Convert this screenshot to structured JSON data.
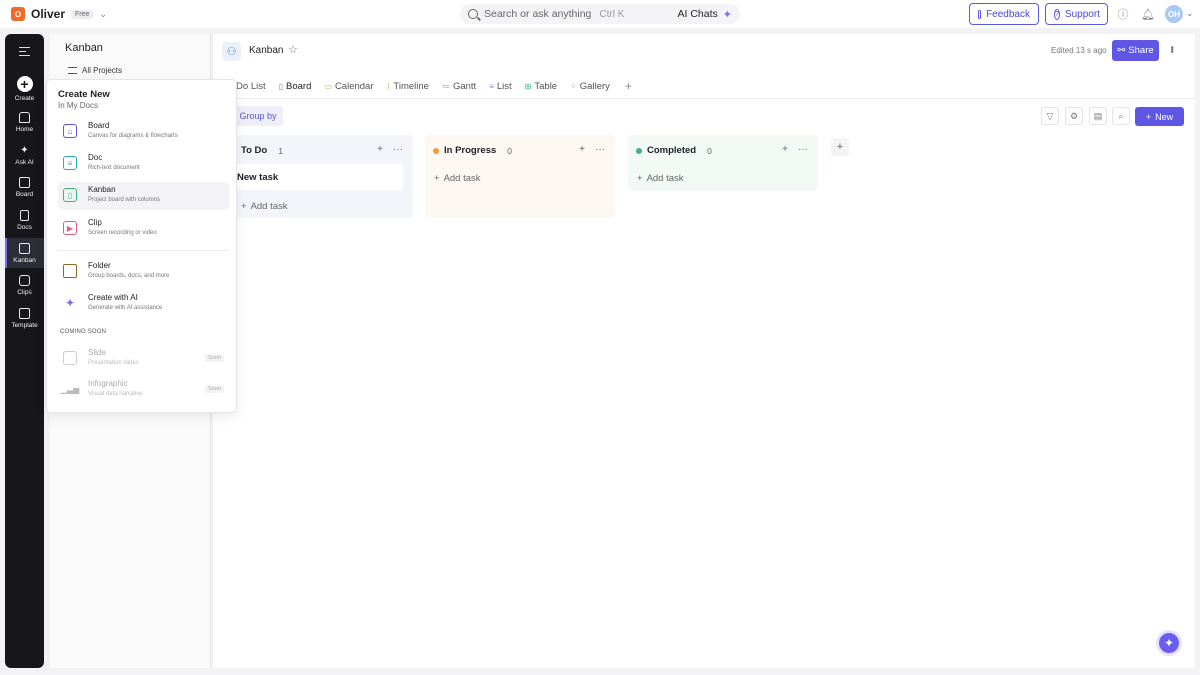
{
  "topbar": {
    "workspace_initial": "O",
    "workspace_name": "Oliver",
    "plan": "Free",
    "search_placeholder": "Search or ask anything",
    "search_shortcut": "Ctrl K",
    "ai_chats": "AI Chats",
    "feedback": "Feedback",
    "support": "Support",
    "user_initials": "OH"
  },
  "rail": {
    "items": [
      {
        "label": "Create"
      },
      {
        "label": "Home"
      },
      {
        "label": "Ask AI"
      },
      {
        "label": "Board"
      },
      {
        "label": "Docs"
      },
      {
        "label": "Kanban"
      },
      {
        "label": "Clips"
      },
      {
        "label": "Template"
      }
    ],
    "active": "Kanban"
  },
  "sidepanel": {
    "title": "Kanban",
    "all_projects": "All Projects"
  },
  "dropdown": {
    "title": "Create New",
    "subtitle": "In My Docs",
    "items": [
      {
        "name": "Board",
        "desc": "Canvas for diagrams & flowcharts"
      },
      {
        "name": "Doc",
        "desc": "Rich-text document"
      },
      {
        "name": "Kanban",
        "desc": "Project board with columns"
      },
      {
        "name": "Clip",
        "desc": "Screen recording or video"
      },
      {
        "name": "Folder",
        "desc": "Group boards, docs, and more"
      },
      {
        "name": "Create with AI",
        "desc": "Generate with AI assistance"
      }
    ],
    "coming_soon_heading": "COMING SOON",
    "coming_soon": [
      {
        "name": "Slide",
        "desc": "Presentation slides",
        "badge": "Soon"
      },
      {
        "name": "Infographic",
        "desc": "Visual data narrative",
        "badge": "Soon"
      }
    ]
  },
  "main": {
    "title": "Kanban",
    "edited": "Edited 13 s ago",
    "share": "Share",
    "tabs": [
      {
        "label": "ToDo List"
      },
      {
        "label": "Board"
      },
      {
        "label": "Calendar"
      },
      {
        "label": "Timeline"
      },
      {
        "label": "Gantt"
      },
      {
        "label": "List"
      },
      {
        "label": "Table"
      },
      {
        "label": "Gallery"
      }
    ],
    "active_tab": "Board",
    "group_by": "Group by",
    "new_button": "New",
    "columns": [
      {
        "name": "To Do",
        "count": "1",
        "color": "#ffffff",
        "bg": "#f4f5fb",
        "add_task": "Add task",
        "tasks": [
          "New task"
        ]
      },
      {
        "name": "In Progress",
        "count": "0",
        "color": "#f29b38",
        "bg": "#fdf8f1",
        "add_task": "Add task",
        "tasks": []
      },
      {
        "name": "Completed",
        "count": "0",
        "color": "#3fb37f",
        "bg": "#f3f9f5",
        "add_task": "Add task",
        "tasks": []
      }
    ]
  },
  "colors": {
    "accent": "#6056e6",
    "rail_bg": "#17171b",
    "workspace_avatar": "#f06a2a"
  }
}
